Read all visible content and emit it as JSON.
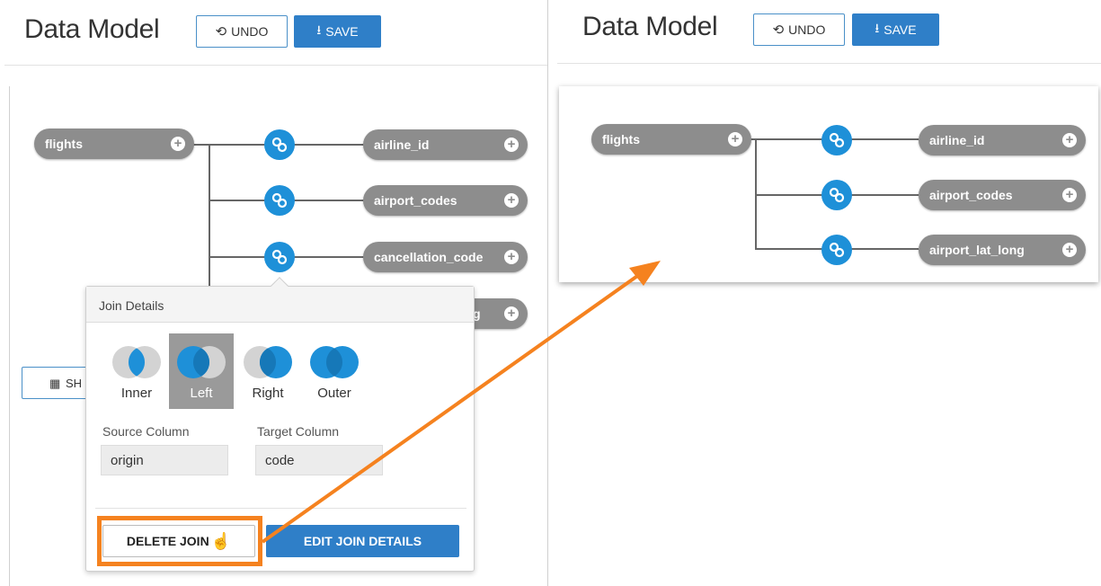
{
  "left": {
    "header": {
      "title": "Data Model",
      "undo_label": "UNDO",
      "save_label": "SAVE"
    },
    "root_table": "flights",
    "tables": [
      "airline_id",
      "airport_codes",
      "cancellation_code",
      "g"
    ],
    "show_button_label": "SH",
    "join_popup": {
      "title": "Join Details",
      "join_types": [
        {
          "label": "Inner"
        },
        {
          "label": "Left"
        },
        {
          "label": "Right"
        },
        {
          "label": "Outer"
        }
      ],
      "selected_join": "Left",
      "source_column_label": "Source Column",
      "source_column_value": "origin",
      "target_column_label": "Target Column",
      "target_column_value": "code",
      "delete_label": "DELETE JOIN",
      "edit_label": "EDIT JOIN DETAILS"
    }
  },
  "right": {
    "header": {
      "title": "Data Model",
      "undo_label": "UNDO",
      "save_label": "SAVE"
    },
    "root_table": "flights",
    "tables": [
      "airline_id",
      "airport_codes",
      "airport_lat_long"
    ]
  },
  "colors": {
    "accent": "#1e90d8",
    "highlight": "#f5821f",
    "pill": "#8d8d8d",
    "save": "#2f7fc8"
  }
}
